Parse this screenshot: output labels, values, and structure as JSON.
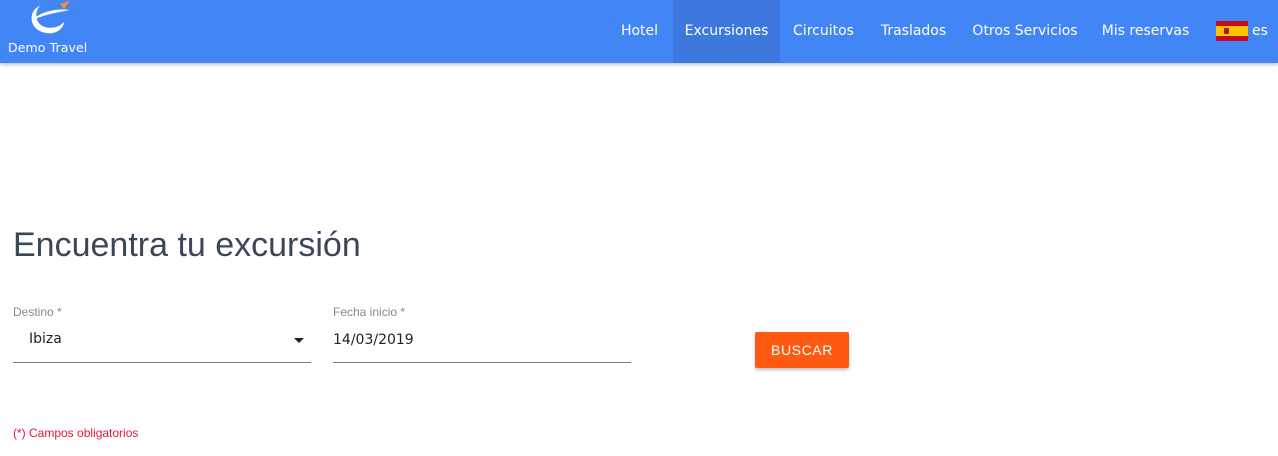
{
  "header": {
    "logo_text": "Demo Travel",
    "nav": [
      {
        "label": "Hotel",
        "active": false
      },
      {
        "label": "Excursiones",
        "active": true
      },
      {
        "label": "Circuitos",
        "active": false
      },
      {
        "label": "Traslados",
        "active": false
      },
      {
        "label": "Otros Servicios",
        "active": false
      },
      {
        "label": "Mis reservas",
        "active": false
      }
    ],
    "language": {
      "flag_icon": "spain-flag-icon",
      "code": "es"
    }
  },
  "main": {
    "title": "Encuentra tu excursión",
    "destination": {
      "label": "Destino *",
      "value": "Ibiza"
    },
    "start_date": {
      "label": "Fecha inicio *",
      "value": "14/03/2019"
    },
    "search_label": "BUSCAR",
    "required_note": "(*) Campos obligatorios"
  },
  "colors": {
    "header_bg": "#4285f4",
    "active_nav_bg": "#3d78df",
    "primary_button": "#ff5a12",
    "title_text": "#3a4759",
    "required_text": "#e5163c"
  }
}
